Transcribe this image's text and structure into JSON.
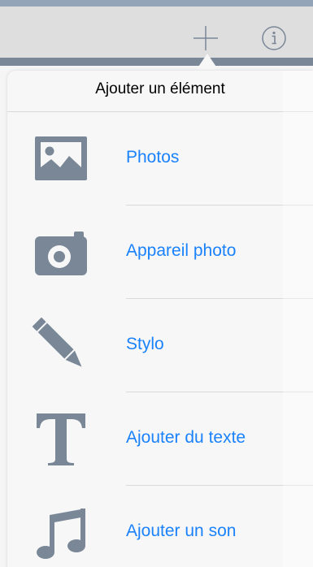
{
  "colors": {
    "accent": "#1a82fb",
    "icon_gray": "#7a8797",
    "toolbar_bg": "#dedede",
    "popover_bg": "#f7f7f8"
  },
  "toolbar": {
    "add_icon": "plus-icon",
    "info_icon": "info-icon"
  },
  "popover": {
    "title": "Ajouter un élément",
    "items": [
      {
        "label": "Photos",
        "icon": "image-icon"
      },
      {
        "label": "Appareil photo",
        "icon": "camera-icon"
      },
      {
        "label": "Stylo",
        "icon": "pencil-icon"
      },
      {
        "label": "Ajouter du texte",
        "icon": "text-icon"
      },
      {
        "label": "Ajouter un son",
        "icon": "music-note-icon"
      }
    ]
  }
}
